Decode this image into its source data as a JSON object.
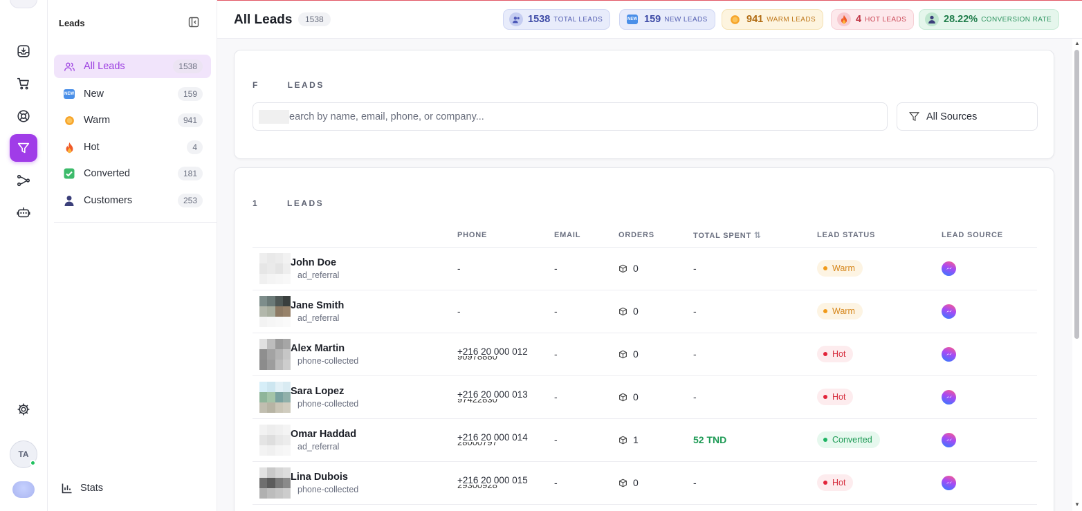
{
  "sidebar": {
    "title": "Leads",
    "items": [
      {
        "label": "All Leads",
        "count": "1538"
      },
      {
        "label": "New",
        "count": "159"
      },
      {
        "label": "Warm",
        "count": "941"
      },
      {
        "label": "Hot",
        "count": "4"
      },
      {
        "label": "Converted",
        "count": "181"
      },
      {
        "label": "Customers",
        "count": "253"
      }
    ],
    "stats_label": "Stats"
  },
  "user": {
    "initials": "TA"
  },
  "header": {
    "title": "All Leads",
    "count": "1538",
    "stats": [
      {
        "value": "1538",
        "label": "TOTAL LEADS",
        "icon": "users-icon",
        "color": "#3d4aa6"
      },
      {
        "value": "159",
        "label": "NEW LEADS",
        "icon": "new-badge-icon",
        "color": "#3d4aa6"
      },
      {
        "value": "941",
        "label": "WARM LEADS",
        "icon": "sun-icon",
        "color": "#b06a10"
      },
      {
        "value": "4",
        "label": "HOT LEADS",
        "icon": "fire-icon",
        "color": "#c03646"
      },
      {
        "value": "28.22%",
        "label": "CONVERSION RATE",
        "icon": "person-icon",
        "color": "#1f7d4a"
      }
    ]
  },
  "filter": {
    "label": "F       LEADS",
    "search_placeholder": "earch by name, email, phone, or company...",
    "sources_label": "All Sources"
  },
  "table": {
    "label": "1       LEADS",
    "columns": [
      "",
      "PHONE",
      "EMAIL",
      "ORDERS",
      "TOTAL SPENT",
      "LEAD STATUS",
      "LEAD SOURCE"
    ],
    "rows": [
      {
        "name": "John Doe",
        "source": "ad_referral",
        "phone": "-",
        "phone_ghost": "",
        "email": "-",
        "orders": "0",
        "spent": "-",
        "status": "Warm"
      },
      {
        "name": "Jane Smith",
        "source": "ad_referral",
        "phone": "-",
        "phone_ghost": "",
        "email": "-",
        "orders": "0",
        "spent": "-",
        "status": "Warm"
      },
      {
        "name": "Alex Martin",
        "source": "phone-collected",
        "phone": "+216 20 000 012",
        "phone_ghost": "90978880",
        "email": "-",
        "orders": "0",
        "spent": "-",
        "status": "Hot"
      },
      {
        "name": "Sara Lopez",
        "source": "phone-collected",
        "phone": "+216 20 000 013",
        "phone_ghost": "97422830",
        "email": "-",
        "orders": "0",
        "spent": "-",
        "status": "Hot"
      },
      {
        "name": "Omar Haddad",
        "source": "ad_referral",
        "phone": "+216 20 000 014",
        "phone_ghost": "28000797",
        "email": "-",
        "orders": "1",
        "spent": "52 TND",
        "status": "Converted"
      },
      {
        "name": "Lina Dubois",
        "source": "phone-collected",
        "phone": "+216 20 000 015",
        "phone_ghost": "29300928",
        "email": "-",
        "orders": "0",
        "spent": "-",
        "status": "Hot"
      }
    ]
  },
  "colors": {
    "accent": "#a03ce8",
    "warm": "#f09a1a",
    "hot": "#e2243a",
    "converted": "#1fb463"
  }
}
